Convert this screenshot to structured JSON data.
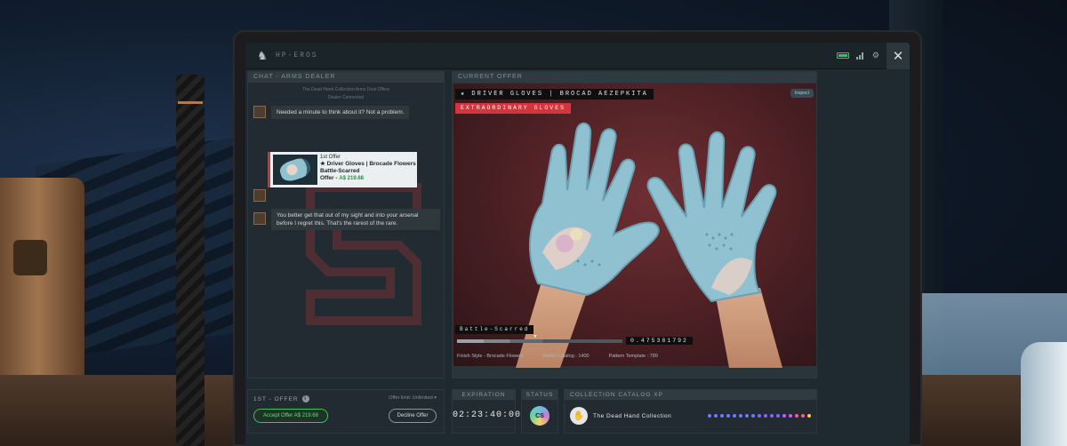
{
  "topbar": {
    "brand": "HP-EROS",
    "brand_sub": ""
  },
  "chat": {
    "header": "Chat - Arms Dealer",
    "meta_line1": "The Dead Hand Collection Arms Deal Offers",
    "meta_line2": "Dealer Connected",
    "message1": "Needed a minute to think about it? Not a problem.",
    "offer": {
      "label": "1st Offer",
      "item": "★ Driver Gloves | Brocade Flowers",
      "wear": "Battle-Scarred",
      "price_label": "Offer - ",
      "price": "A$ 219.68"
    },
    "message2": "You better get that out of my sight and into your arsenal before I regret this. That's the rarest of the rare."
  },
  "current": {
    "header": "Current Offer",
    "item_name": "★ DRIVER GLOVES | BROCAD AEZEPKITA",
    "rarity": "EXTRAORDINARY GLOVES",
    "inspect_label": "Inspect",
    "wear_label": "Battle-Scarred",
    "float_value": "0.475381792",
    "float_fraction": 0.475,
    "finish_name": "Finish Style - Brocade Flowers",
    "finish_catalog": "Finish Catalog : 1400",
    "pattern_template": "Pattern Template : 789"
  },
  "offer_bar": {
    "title": "1ST - OFFER",
    "limit": "Offer limit: Unlimited ▾",
    "accept_label": "Accept Offer A$ 219.68",
    "decline_label": "Decline Offer"
  },
  "expiration": {
    "header": "Expiration",
    "time": "02:23:40:00"
  },
  "status": {
    "header": "Status",
    "icon_text": "CS"
  },
  "xp": {
    "header": "Collection Catalog XP",
    "collection": "The Dead Hand Collection",
    "dots": [
      "#6b7bff",
      "#6b7bff",
      "#6b7bff",
      "#6b7bff",
      "#6b7bff",
      "#6b7bff",
      "#6b7bff",
      "#6b7bff",
      "#8a63ff",
      "#8a63ff",
      "#8a63ff",
      "#8a63ff",
      "#c45cff",
      "#c45cff",
      "#ff5a8a",
      "#ff5a8a",
      "#ffcc33"
    ]
  },
  "colors": {
    "accent_red": "#d2363c",
    "accept_green": "#3fbf5f",
    "panel": "#212b31"
  }
}
